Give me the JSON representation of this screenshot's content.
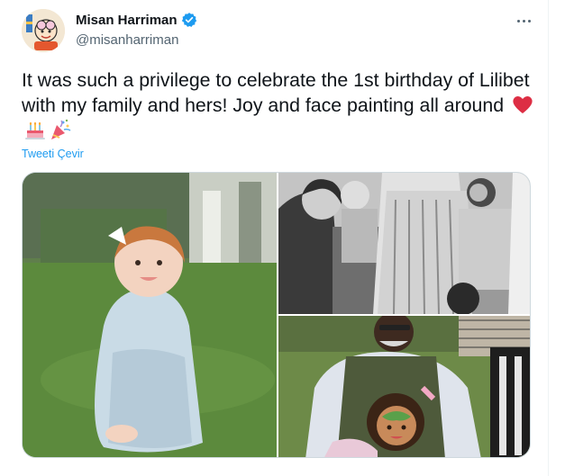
{
  "tweet": {
    "author_name": "Misan Harriman",
    "author_handle": "@misanharriman",
    "text": "It was such a privilege to celebrate the 1st birthday of Lilibet with my family and hers! Joy and face painting all around",
    "emojis": [
      "red-heart-icon",
      "birthday-cake-icon",
      "party-popper-icon"
    ],
    "translate_label": "Tweeti Çevir",
    "verified": true
  },
  "colors": {
    "accent": "#1d9bf0",
    "text_primary": "#0f1419",
    "text_secondary": "#536471",
    "border": "#cfd9de"
  },
  "media": {
    "photo_count": 3
  }
}
